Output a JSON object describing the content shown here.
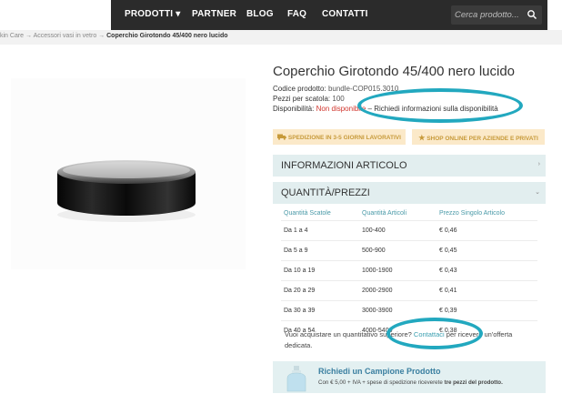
{
  "nav": {
    "items": [
      {
        "label": "PRODOTTI ▾"
      },
      {
        "label": "PARTNER"
      },
      {
        "label": "BLOG"
      },
      {
        "label": "FAQ"
      },
      {
        "label": "CONTATTI"
      }
    ],
    "search_placeholder": "Cerca prodotto..."
  },
  "breadcrumb": {
    "part1": "kin Care",
    "sep": " → ",
    "part2": "Accessori vasi in vetro",
    "current": "Coperchio Girotondo 45/400 nero lucido"
  },
  "product": {
    "title": "Coperchio Girotondo 45/400 nero lucido",
    "code_label": "Codice prodotto:",
    "code_value": "bundle-COP015.3010",
    "pack_label": "Pezzi per scatola:",
    "pack_value": "100",
    "avail_label": "Disponibilità:",
    "avail_value": "Non disponibile",
    "avail_dash": " – ",
    "avail_link": "Richiedi informazioni sulla disponibilità"
  },
  "badges": {
    "shipping": "SPEDIZIONE IN 3-5 GIORNI LAVORATIVI",
    "shop": "SHOP ONLINE PER AZIENDE E PRIVATI"
  },
  "accordion": {
    "info": "INFORMAZIONI ARTICOLO",
    "qty": "QUANTITÀ/PREZZI"
  },
  "price_table": {
    "headers": [
      "Quantità Scatole",
      "Quantità Articoli",
      "Prezzo Singolo Articolo"
    ],
    "rows": [
      [
        "Da 1 a 4",
        "100-400",
        "€ 0,46"
      ],
      [
        "Da 5 a 9",
        "500-900",
        "€ 0,45"
      ],
      [
        "Da 10 a 19",
        "1000-1900",
        "€ 0,43"
      ],
      [
        "Da 20 a 29",
        "2000-2900",
        "€ 0,41"
      ],
      [
        "Da 30 a 39",
        "3000-3900",
        "€ 0,39"
      ],
      [
        "Da 40 a 54",
        "4000-5400",
        "€ 0,38"
      ]
    ]
  },
  "note": {
    "before": "Vuoi acquistare un quantitativo superiore? ",
    "link": "Contattaci",
    "after": " per ricevere un'offerta dedicata."
  },
  "sample": {
    "title": "Richiedi un Campione Prodotto",
    "text_before": "Con € 5,00 + IVA + spese di spedizione riceverete ",
    "text_bold": "tre pezzi del prodotto."
  },
  "colors": {
    "nav_bg": "#2b2b2b",
    "accent": "#22a8bf",
    "unavailable": "#d0342c",
    "badge_bg": "#fbe9c9"
  }
}
